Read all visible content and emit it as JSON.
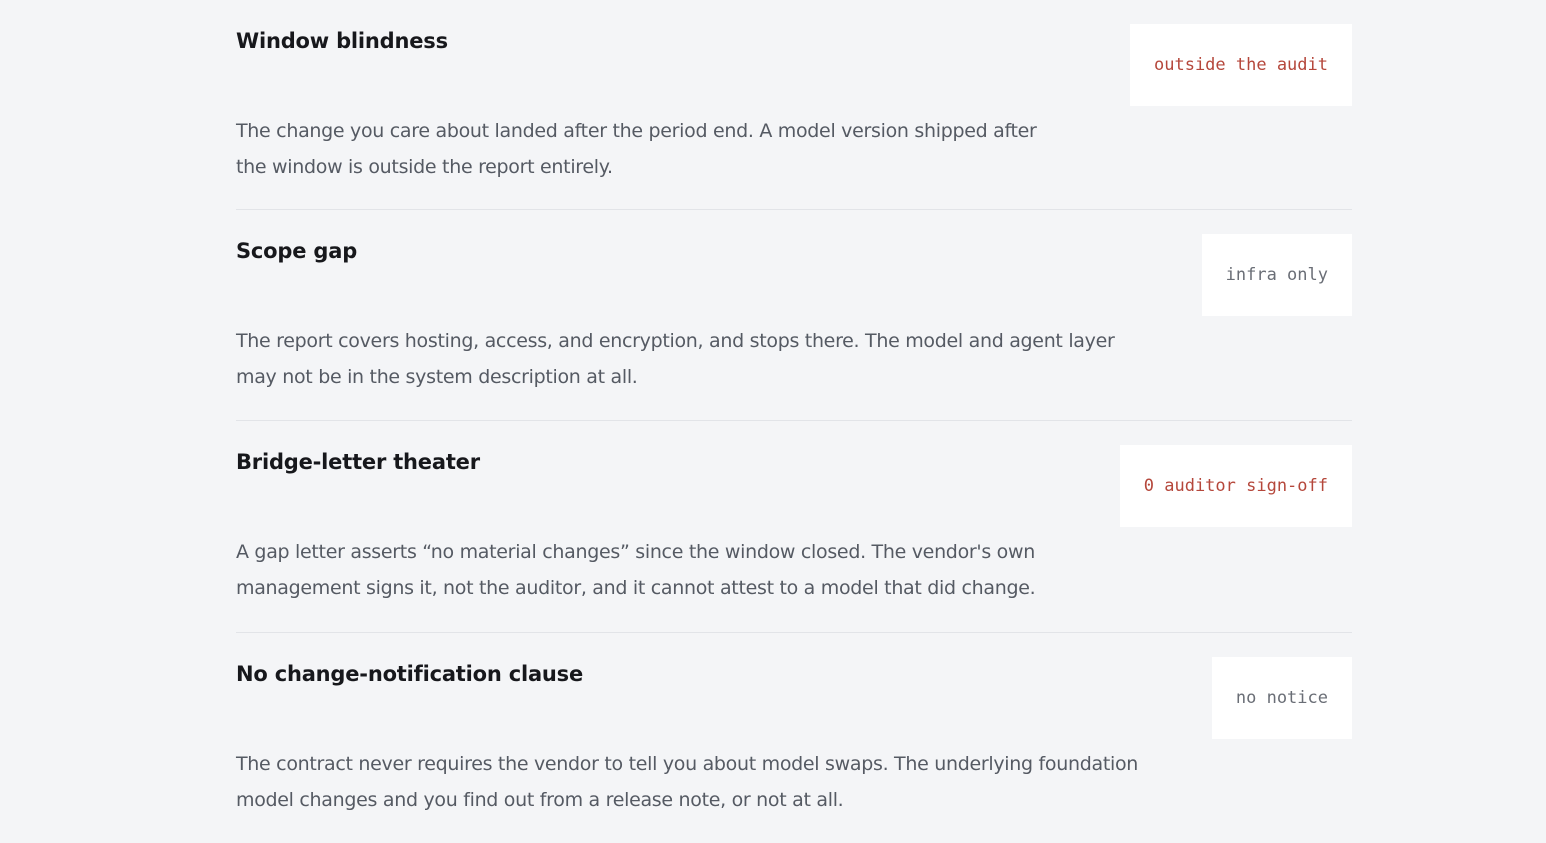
{
  "items": [
    {
      "title": "Window blindness",
      "description_lines": [
        "The change you care about landed after the period end. A model version shipped after",
        "the window is outside the report entirely."
      ],
      "tag": "outside the audit",
      "tag_color": "#b5473b"
    },
    {
      "title": "Scope gap",
      "description_lines": [
        "The report covers hosting, access, and encryption, and stops there. The model and agent layer",
        "may not be in the system description at all."
      ],
      "tag": "infra only",
      "tag_color": "#6a6e76"
    },
    {
      "title": "Bridge-letter theater",
      "description_lines": [
        "A gap letter asserts “no material changes” since the window closed. The vendor's own",
        "management signs it, not the auditor, and it cannot attest to a model that did change."
      ],
      "tag": "0 auditor sign-off",
      "tag_color": "#b5473b"
    },
    {
      "title": "No change-notification clause",
      "description_lines": [
        "The contract never requires the vendor to tell you about model swaps. The underlying foundation",
        "model changes and you find out from a release note, or not at all."
      ],
      "tag": "no notice",
      "tag_color": "#6a6e76"
    }
  ]
}
